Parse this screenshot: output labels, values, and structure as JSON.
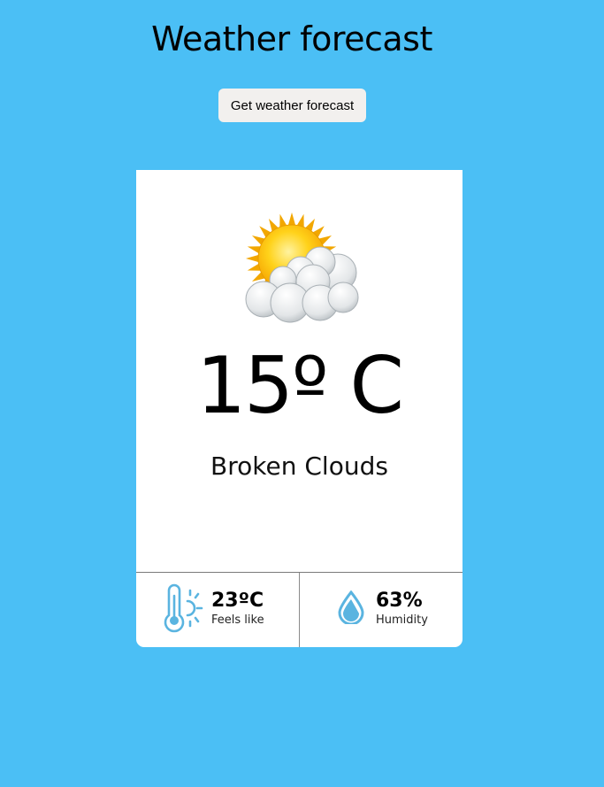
{
  "header": {
    "title": "Weather forecast",
    "button_label": "Get weather forecast"
  },
  "weather": {
    "icon": "sun-behind-clouds-icon",
    "temperature": "15º C",
    "description": "Broken Clouds"
  },
  "details": {
    "feels_like": {
      "icon": "thermometer-sun-icon",
      "value": "23ºC",
      "label": "Feels like"
    },
    "humidity": {
      "icon": "water-drop-icon",
      "value": "63%",
      "label": "Humidity"
    }
  },
  "colors": {
    "page_background": "#4bbff5",
    "card_background": "#ffffff",
    "button_background": "#f2f0ee",
    "icon_accent": "#5ab4e0"
  }
}
